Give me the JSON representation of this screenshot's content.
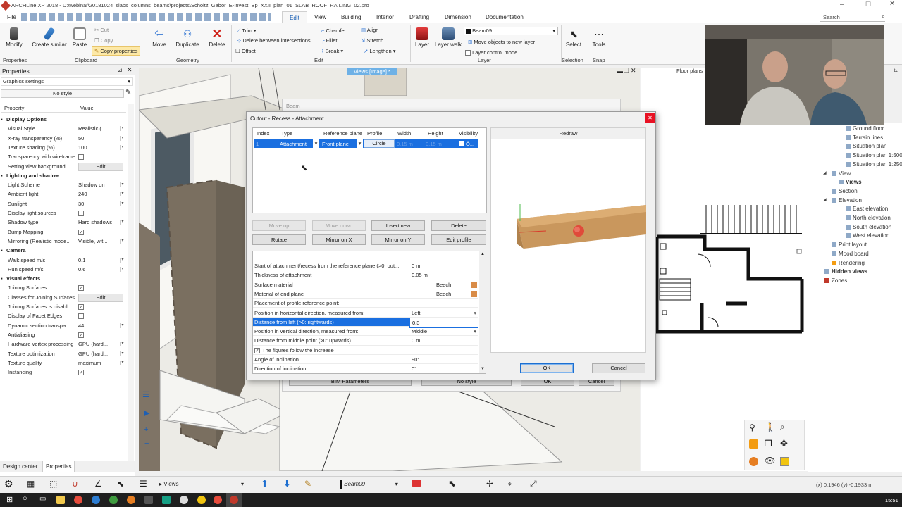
{
  "app_title": "ARCHLine.XP 2018 - D:\\webinar\\20181024_slabs_columns_beams\\projects\\Scholtz_Gabor_E-Invest_Bp_XXII_plan_01_SLAB_ROOF_RAILING_02.pro",
  "menu": [
    "File",
    "Edit",
    "View",
    "Building",
    "Interior",
    "Drafting",
    "Dimension",
    "Documentation"
  ],
  "search_placeholder": "Search",
  "ribbon": {
    "modify": "Modify",
    "create_similar": "Create similar",
    "paste": "Paste",
    "cut": "Cut",
    "copy": "Copy",
    "copy_properties": "Copy properties",
    "move": "Move",
    "duplicate": "Duplicate",
    "delete": "Delete",
    "trim": "Trim",
    "delete_between": "Delete between intersections",
    "offset": "Offset",
    "chamfer": "Chamfer",
    "fillet": "Fillet",
    "break": "Break",
    "align": "Align",
    "stretch": "Stretch",
    "lengthen": "Lengthen",
    "layer": "Layer",
    "layer_walk": "Layer walk",
    "layer_value": "Beam09",
    "move_objects": "Move objects to new layer",
    "layer_control": "Layer control mode",
    "select": "Select",
    "tools": "Tools",
    "groups": {
      "properties": "Properties",
      "clipboard": "Clipboard",
      "geometry": "Geometry",
      "edit": "Edit",
      "layer": "Layer",
      "selection": "Selection",
      "snap": "Snap"
    }
  },
  "properties_panel": {
    "title": "Properties",
    "graphics_settings": "Graphics settings",
    "no_style": "No style",
    "col_property": "Property",
    "col_value": "Value",
    "rows": [
      {
        "k": "Display Options",
        "sec": true
      },
      {
        "k": "Visual Style",
        "v": "Realistic (...",
        "dd": true
      },
      {
        "k": "X-ray transparency (%)",
        "v": "50",
        "dd": true
      },
      {
        "k": "Texture shading (%)",
        "v": "100",
        "dd": true
      },
      {
        "k": "Transparency with wireframe",
        "chk": false
      },
      {
        "k": "Setting view background",
        "btn": "Edit"
      },
      {
        "k": "Lighting and shadow",
        "sec": true
      },
      {
        "k": "Light Scheme",
        "v": "Shadow on",
        "dd": true
      },
      {
        "k": "Ambient light",
        "v": "240",
        "dd": true
      },
      {
        "k": "Sunlight",
        "v": "30",
        "dd": true
      },
      {
        "k": "Display light sources",
        "chk": false
      },
      {
        "k": "Shadow type",
        "v": "Hard shadows",
        "dd": true
      },
      {
        "k": "Bump Mapping",
        "chk": true
      },
      {
        "k": "Mirroring (Realistic mode...",
        "v": "Visible, wit...",
        "dd": true
      },
      {
        "k": "Camera",
        "sec": true
      },
      {
        "k": "Walk speed m/s",
        "v": "0.1",
        "dd": true
      },
      {
        "k": "Run speed m/s",
        "v": "0.6",
        "dd": true
      },
      {
        "k": "Visual effects",
        "sec": true
      },
      {
        "k": "Joining Surfaces",
        "chk": true
      },
      {
        "k": "Classes for Joining Surfaces",
        "btn": "Edit"
      },
      {
        "k": "Joining Surfaces is disabl...",
        "chk": true
      },
      {
        "k": "Display of Facet Edges",
        "chk": false
      },
      {
        "k": "Dynamic section transpa...",
        "v": "44",
        "dd": true
      },
      {
        "k": "Antialiasing",
        "chk": true
      },
      {
        "k": "Hardware vertex processing",
        "v": "GPU (hard...",
        "dd": true
      },
      {
        "k": "Texture optimization",
        "v": "GPU (hard...",
        "dd": true
      },
      {
        "k": "Texture quality",
        "v": "maximum",
        "dd": true
      },
      {
        "k": "Instancing",
        "chk": true
      }
    ],
    "tabs": [
      "Design center",
      "Properties"
    ]
  },
  "views_tab": "Views [Image] *",
  "floor_tab": "Floor plans",
  "tree": [
    {
      "t": "Ground floor",
      "i": 54
    },
    {
      "t": "Terrain lines",
      "i": 54
    },
    {
      "t": "Situation plan",
      "i": 54
    },
    {
      "t": "Situation plan 1:500",
      "i": 54
    },
    {
      "t": "Situation plan 1:250",
      "i": 54
    },
    {
      "t": "View",
      "i": 34
    },
    {
      "t": "Views",
      "i": 44,
      "b": true
    },
    {
      "t": "Section",
      "i": 34
    },
    {
      "t": "Elevation",
      "i": 34
    },
    {
      "t": "East elevation",
      "i": 54
    },
    {
      "t": "North elevation",
      "i": 54
    },
    {
      "t": "South elevation",
      "i": 54
    },
    {
      "t": "West elevation",
      "i": 54
    },
    {
      "t": "Print layout",
      "i": 34
    },
    {
      "t": "Mood board",
      "i": 34
    },
    {
      "t": "Rendering",
      "i": 34
    },
    {
      "t": "Hidden views",
      "i": 24,
      "b": true
    },
    {
      "t": "Zones",
      "i": 24
    }
  ],
  "beam_dialog": {
    "title": "Beam",
    "bim_parameters": "BIM Parameters",
    "no_style": "No style",
    "ok": "OK",
    "cancel": "Cancel"
  },
  "dialog": {
    "title": "Cutout - Recess - Attachment",
    "columns": [
      "Index",
      "Type",
      "Reference plane",
      "Profile",
      "Width",
      "Height",
      "Visibility"
    ],
    "row": {
      "index": "1",
      "type": "Attachment",
      "reference_plane": "Front plane",
      "profile": "Circle",
      "width": "0.15 m",
      "height": "0.15 m",
      "visibility": "Ö..."
    },
    "buttons": {
      "move_up": "Move up",
      "move_down": "Move down",
      "insert_new": "Insert new",
      "delete": "Delete",
      "rotate": "Rotate",
      "mirror_x": "Mirror on X",
      "mirror_y": "Mirror on Y",
      "edit_profile": "Edit profile",
      "redraw": "Redraw",
      "ok": "OK",
      "cancel": "Cancel"
    },
    "params": [
      {
        "k": "Start of attachment/recess from the reference plane (>0: out...",
        "v": "0 m"
      },
      {
        "k": "Thickness of attachment",
        "v": "0.05 m"
      },
      {
        "k": "Surface material",
        "v": "Beech",
        "sw": true
      },
      {
        "k": "Material of end plane",
        "v": "Beech",
        "sw": true
      },
      {
        "k": "Placement of profile reference point:",
        "v": ""
      },
      {
        "k": "Position in horizontal direction, measured from:",
        "v": "Left",
        "dd": true
      },
      {
        "k": "Distance from left (>0: rightwards)",
        "v": "0,3",
        "sel": true
      },
      {
        "k": "Position in vertical direction, measured from:",
        "v": "Middle",
        "dd": true
      },
      {
        "k": "Distance from middle point (>0: upwards)",
        "v": "0 m"
      },
      {
        "k": "The figures follow the increase",
        "chk": true
      },
      {
        "k": "Angle of inclination",
        "v": "90°"
      },
      {
        "k": "Direction of inclination",
        "v": "0°"
      }
    ]
  },
  "status": {
    "views": "Views",
    "layer": "Beam09",
    "coords": "(x) 0.1946  (y) -0.1933 m"
  },
  "clock": "15:51"
}
